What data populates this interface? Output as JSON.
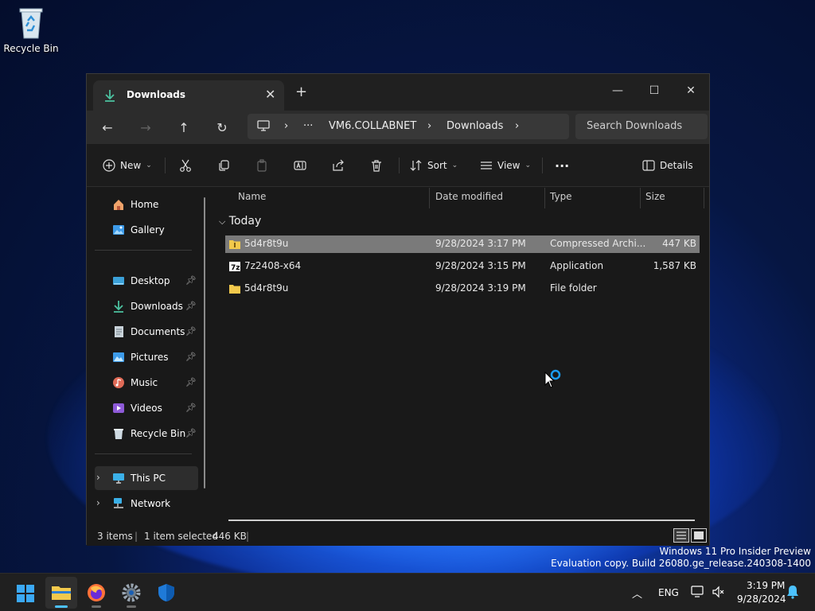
{
  "desktop": {
    "recycle_bin_label": "Recycle Bin"
  },
  "window": {
    "tab_title": "Downloads",
    "new_tab_glyph": "+",
    "controls": {
      "minimize": "—",
      "maximize": "☐",
      "close": "✕"
    },
    "breadcrumb": [
      "VM6.COLLABNET",
      "Downloads"
    ],
    "breadcrumb_more": "···",
    "search_placeholder": "Search Downloads",
    "toolbar": {
      "new_label": "New",
      "sort_label": "Sort",
      "view_label": "View",
      "more_glyph": "···",
      "details_label": "Details"
    },
    "sidebar": {
      "top": [
        {
          "label": "Home",
          "icon": "home-icon"
        },
        {
          "label": "Gallery",
          "icon": "gallery-icon"
        }
      ],
      "pinned": [
        {
          "label": "Desktop",
          "icon": "desktop-folder-icon"
        },
        {
          "label": "Downloads",
          "icon": "downloads-folder-icon"
        },
        {
          "label": "Documents",
          "icon": "documents-folder-icon"
        },
        {
          "label": "Pictures",
          "icon": "pictures-folder-icon"
        },
        {
          "label": "Music",
          "icon": "music-folder-icon"
        },
        {
          "label": "Videos",
          "icon": "videos-folder-icon"
        },
        {
          "label": "Recycle Bin",
          "icon": "recycle-bin-icon"
        }
      ],
      "bottom": [
        {
          "label": "This PC",
          "icon": "this-pc-icon"
        },
        {
          "label": "Network",
          "icon": "network-icon"
        }
      ]
    },
    "columns": {
      "name": "Name",
      "date": "Date modified",
      "type": "Type",
      "size": "Size"
    },
    "group_label": "Today",
    "files": [
      {
        "name": "5d4r8t9u",
        "date": "9/28/2024 3:17 PM",
        "type": "Compressed Archi...",
        "size": "447 KB",
        "icon": "zip-folder-icon",
        "selected": true
      },
      {
        "name": "7z2408-x64",
        "date": "9/28/2024 3:15 PM",
        "type": "Application",
        "size": "1,587 KB",
        "icon": "7zip-app-icon",
        "selected": false
      },
      {
        "name": "5d4r8t9u",
        "date": "9/28/2024 3:19 PM",
        "type": "File folder",
        "size": "",
        "icon": "folder-icon",
        "selected": false
      }
    ],
    "status": {
      "items": "3 items",
      "selected": "1 item selected",
      "selected_size": "446 KB"
    }
  },
  "watermark": {
    "line1": "Windows 11 Pro Insider Preview",
    "line2": "Evaluation copy. Build 26080.ge_release.240308-1400"
  },
  "taskbar": {
    "apps": [
      "start-icon",
      "file-explorer-icon",
      "firefox-icon",
      "settings-icon",
      "defender-icon"
    ],
    "tray": {
      "language": "ENG",
      "time": "3:19 PM",
      "date": "9/28/2024"
    }
  },
  "colors": {
    "accent": "#4cc2ff",
    "selection": "#7a7a7a",
    "window_bg": "#191919"
  }
}
